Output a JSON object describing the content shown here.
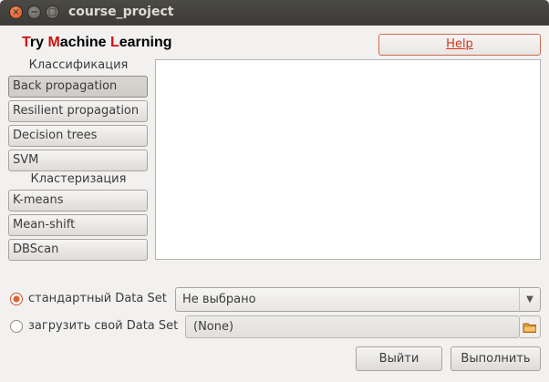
{
  "window": {
    "title": "course_project",
    "controls": {
      "close": "×",
      "minimize": "−",
      "maximize": "□"
    }
  },
  "app_title": {
    "p1": "T",
    "p2": "ry ",
    "p3": "M",
    "p4": "achine ",
    "p5": "L",
    "p6": "earning"
  },
  "help": {
    "label": "Help"
  },
  "sections": {
    "classification": "Классификация",
    "clustering": "Кластеризация"
  },
  "classification_methods": [
    "Back propagation",
    "Resilient propagation",
    "Decision trees",
    "SVM"
  ],
  "clustering_methods": [
    "K-means",
    "Mean-shift",
    "DBScan"
  ],
  "dataset": {
    "standard_label": "стандартный Data Set",
    "standard_selected": "Не выбрано",
    "custom_label": "загрузить свой Data Set",
    "custom_value": "(None)"
  },
  "actions": {
    "exit": "Выйти",
    "run": "Выполнить"
  },
  "colors": {
    "accent": "#d01010",
    "radio": "#e0602f",
    "titlebar": "#3c3b37"
  },
  "icons": {
    "combo_arrow": "triangle-down-icon",
    "folder": "folder-icon"
  }
}
